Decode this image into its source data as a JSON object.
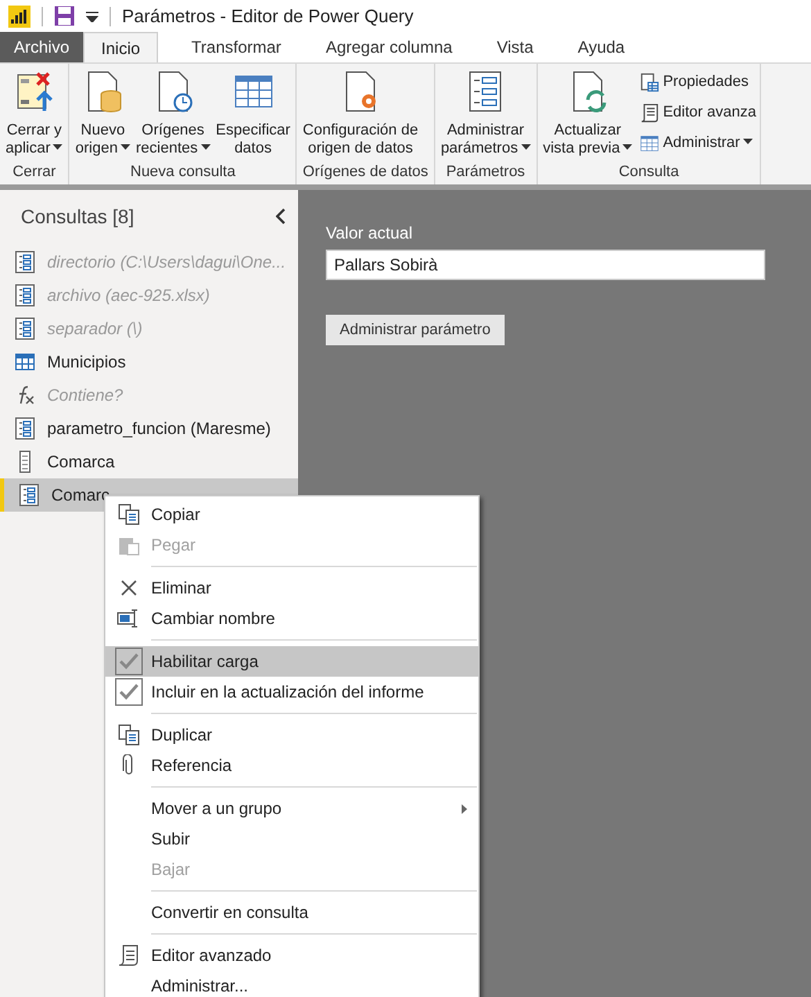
{
  "window": {
    "title": "Parámetros - Editor de Power Query"
  },
  "tabs": [
    {
      "label": "Archivo",
      "kind": "file",
      "selected": false
    },
    {
      "label": "Inicio",
      "kind": "tab",
      "selected": true
    },
    {
      "label": "Transformar",
      "kind": "tab",
      "selected": false
    },
    {
      "label": "Agregar columna",
      "kind": "tab",
      "selected": false
    },
    {
      "label": "Vista",
      "kind": "tab",
      "selected": false
    },
    {
      "label": "Ayuda",
      "kind": "tab",
      "selected": false
    }
  ],
  "ribbon": {
    "groups": [
      {
        "label": "Cerrar",
        "buttons": [
          {
            "kind": "large",
            "lines": [
              "Cerrar y",
              "aplicar"
            ],
            "dropdown": true
          }
        ]
      },
      {
        "label": "Nueva consulta",
        "buttons": [
          {
            "kind": "large",
            "lines": [
              "Nuevo",
              "origen"
            ],
            "dropdown": true
          },
          {
            "kind": "large",
            "lines": [
              "Orígenes",
              "recientes"
            ],
            "dropdown": true
          },
          {
            "kind": "large",
            "lines": [
              "Especificar",
              "datos"
            ],
            "dropdown": false
          }
        ]
      },
      {
        "label": "Orígenes de datos",
        "buttons": [
          {
            "kind": "large",
            "lines": [
              "Configuración de",
              "origen de datos"
            ],
            "dropdown": false
          }
        ]
      },
      {
        "label": "Parámetros",
        "buttons": [
          {
            "kind": "large",
            "lines": [
              "Administrar",
              "parámetros"
            ],
            "dropdown": true
          }
        ]
      },
      {
        "label": "Consulta",
        "buttons": [
          {
            "kind": "large",
            "lines": [
              "Actualizar",
              "vista previa"
            ],
            "dropdown": true
          },
          {
            "kind": "small",
            "lines": [
              "Propiedades"
            ],
            "dropdown": false
          },
          {
            "kind": "small",
            "lines": [
              "Editor avanza"
            ],
            "dropdown": false
          },
          {
            "kind": "small",
            "lines": [
              "Administrar"
            ],
            "dropdown": true
          }
        ]
      }
    ]
  },
  "queries": {
    "title": "Consultas [8]",
    "items": [
      {
        "label": "directorio (C:\\Users\\dagui\\One...",
        "kind": "parameter",
        "disabled": true,
        "selected": false
      },
      {
        "label": "archivo (aec-925.xlsx)",
        "kind": "parameter",
        "disabled": true,
        "selected": false
      },
      {
        "label": "separador (\\)",
        "kind": "parameter",
        "disabled": true,
        "selected": false
      },
      {
        "label": "Municipios",
        "kind": "table",
        "disabled": false,
        "selected": false
      },
      {
        "label": "Contiene?",
        "kind": "function",
        "disabled": true,
        "selected": false
      },
      {
        "label": "parametro_funcion (Maresme)",
        "kind": "parameter",
        "disabled": false,
        "selected": false
      },
      {
        "label": "Comarca",
        "kind": "list",
        "disabled": false,
        "selected": false
      },
      {
        "label": "Comarc",
        "kind": "parameter",
        "disabled": false,
        "selected": true
      }
    ]
  },
  "parameter": {
    "label": "Valor actual",
    "value": "Pallars Sobirà",
    "button": "Administrar parámetro"
  },
  "context_menu": {
    "items": [
      {
        "kind": "item",
        "label": "Copiar",
        "disabled": false,
        "checked": false,
        "selected": false,
        "submenu": false
      },
      {
        "kind": "item",
        "label": "Pegar",
        "disabled": true,
        "checked": false,
        "selected": false,
        "submenu": false
      },
      {
        "kind": "separator"
      },
      {
        "kind": "item",
        "label": "Eliminar",
        "disabled": false,
        "checked": false,
        "selected": false,
        "submenu": false
      },
      {
        "kind": "item",
        "label": "Cambiar nombre",
        "disabled": false,
        "checked": false,
        "selected": false,
        "submenu": false
      },
      {
        "kind": "separator"
      },
      {
        "kind": "item",
        "label": "Habilitar carga",
        "disabled": false,
        "checked": true,
        "selected": true,
        "submenu": false
      },
      {
        "kind": "item",
        "label": "Incluir en la actualización del informe",
        "disabled": false,
        "checked": true,
        "selected": false,
        "submenu": false
      },
      {
        "kind": "separator"
      },
      {
        "kind": "item",
        "label": "Duplicar",
        "disabled": false,
        "checked": false,
        "selected": false,
        "submenu": false
      },
      {
        "kind": "item",
        "label": "Referencia",
        "disabled": false,
        "checked": false,
        "selected": false,
        "submenu": false
      },
      {
        "kind": "separator"
      },
      {
        "kind": "item",
        "label": "Mover a un grupo",
        "disabled": false,
        "checked": false,
        "selected": false,
        "submenu": true
      },
      {
        "kind": "item",
        "label": "Subir",
        "disabled": false,
        "checked": false,
        "selected": false,
        "submenu": false
      },
      {
        "kind": "item",
        "label": "Bajar",
        "disabled": true,
        "checked": false,
        "selected": false,
        "submenu": false
      },
      {
        "kind": "separator"
      },
      {
        "kind": "item",
        "label": "Convertir en consulta",
        "disabled": false,
        "checked": false,
        "selected": false,
        "submenu": false
      },
      {
        "kind": "separator"
      },
      {
        "kind": "item",
        "label": "Editor avanzado",
        "disabled": false,
        "checked": false,
        "selected": false,
        "submenu": false
      },
      {
        "kind": "item",
        "label": "Administrar...",
        "disabled": false,
        "checked": false,
        "selected": false,
        "submenu": false
      }
    ]
  }
}
